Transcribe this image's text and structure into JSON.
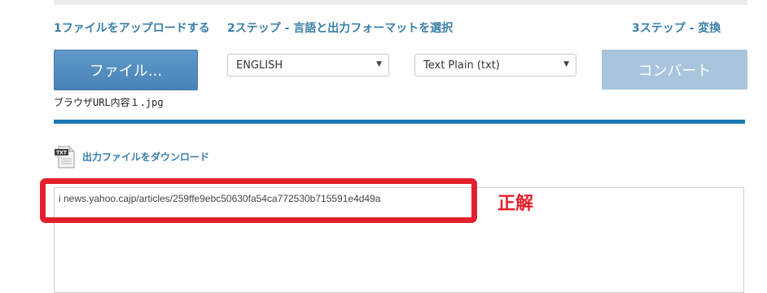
{
  "steps": {
    "step1": "1ファイルをアップロードする",
    "step2": "2ステップ - 言語と出力フォーマットを選択",
    "step3": "3ステップ - 変換"
  },
  "file_button_label": "ファイル...",
  "language_select": {
    "value": "ENGLISH"
  },
  "format_select": {
    "value": "Text Plain (txt)"
  },
  "convert_button_label": "コンバート",
  "uploaded_filename": "ブラウザURL内容１.jpg",
  "progress_percent": 100,
  "download_link_label": "出力ファイルをダウンロード",
  "download_icon_text": "TXT",
  "output_text": "i news.yahoo.cajp/articles/259ffe9ebc50630fa54ca772530b715591e4d49a",
  "annotation_label": "正解",
  "colors": {
    "accent": "#1b79b8",
    "step_text": "#3a7fa8",
    "annotation_red": "#e5202d",
    "convert_disabled": "#a9c4dd"
  }
}
